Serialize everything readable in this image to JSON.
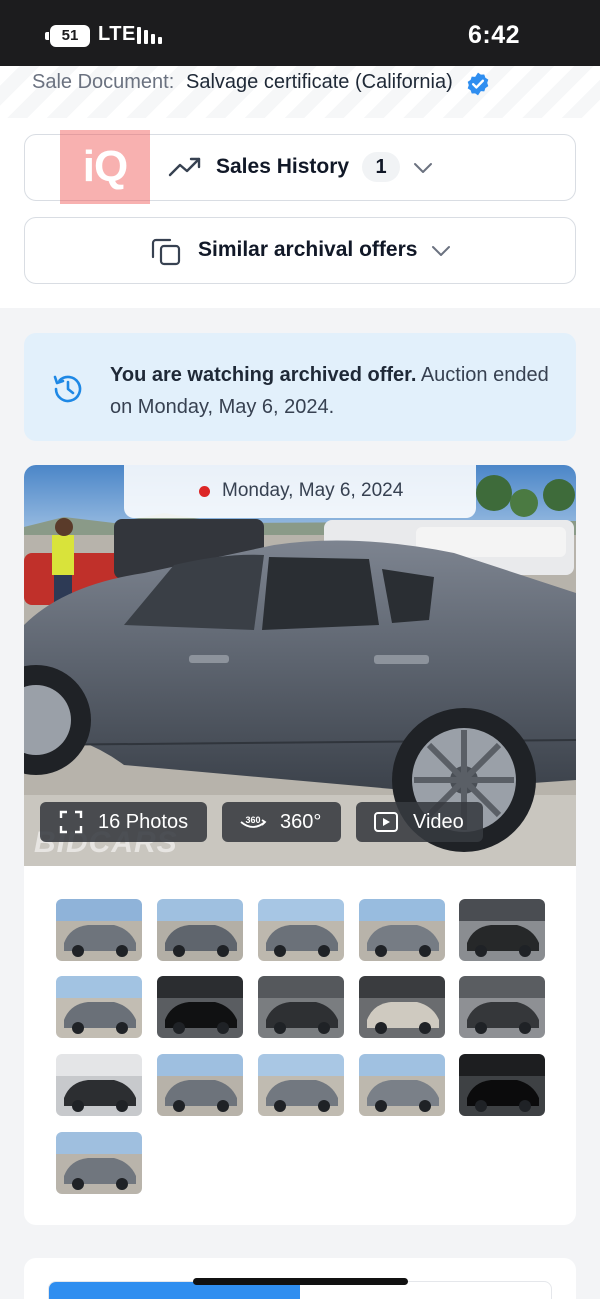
{
  "status_bar": {
    "battery": "51",
    "network": "LTE",
    "time": "6:42"
  },
  "sale_document": {
    "label": "Sale Document:",
    "value": "Salvage certificate (California)",
    "verified_icon": "verified-badge-icon"
  },
  "watermark_logo": "iQ",
  "sales_history": {
    "label": "Sales History",
    "count": "1",
    "icon": "trending-up-icon"
  },
  "similar_offers": {
    "label": "Similar archival offers",
    "icon": "copy-icon"
  },
  "notice": {
    "bold": "You are watching archived offer.",
    "rest": " Auction ended on Monday, May 6, 2024.",
    "icon": "history-icon"
  },
  "gallery": {
    "date": "Monday, May 6, 2024",
    "photos_label": "16 Photos",
    "spin_label": "360°",
    "video_label": "Video",
    "watermark": "BIDCARS",
    "thumbnails": [
      {
        "name": "thumb-front-left"
      },
      {
        "name": "thumb-front"
      },
      {
        "name": "thumb-front-right"
      },
      {
        "name": "thumb-rear-right"
      },
      {
        "name": "thumb-interior-front"
      },
      {
        "name": "thumb-rear-damage"
      },
      {
        "name": "thumb-dashboard"
      },
      {
        "name": "thumb-rear-seat"
      },
      {
        "name": "thumb-label"
      },
      {
        "name": "thumb-engine"
      },
      {
        "name": "thumb-key-fob"
      },
      {
        "name": "thumb-front-view"
      },
      {
        "name": "thumb-side"
      },
      {
        "name": "thumb-rear-left"
      },
      {
        "name": "thumb-instruments"
      },
      {
        "name": "thumb-rear-view"
      }
    ]
  },
  "progress": {
    "fraction": 0.5,
    "color": "#2f8ef0"
  },
  "colors": {
    "accent": "#2f8ef0",
    "notice_bg": "#e2f0fb",
    "dot": "#dc2626"
  }
}
